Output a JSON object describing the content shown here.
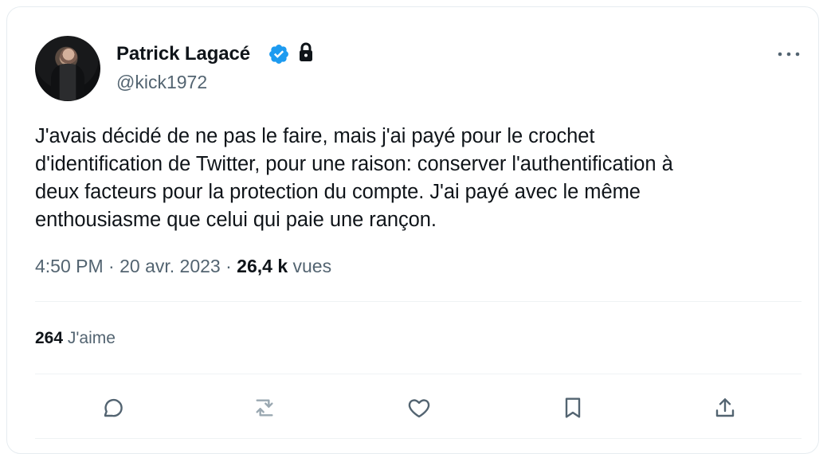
{
  "tweet": {
    "author": {
      "display_name": "Patrick Lagacé",
      "handle": "@kick1972",
      "avatar_icon": "profile-photo"
    },
    "badges": {
      "verified_icon": "verified-badge-icon",
      "verified_color": "#1d9bf0",
      "protected_icon": "lock-icon"
    },
    "more_icon": "more-horizontal-icon",
    "text": "J'avais décidé de ne pas le faire, mais j'ai payé pour le crochet\nd'identification de Twitter, pour une raison: conserver l'authentification à\ndeux facteurs pour la protection du compte. J'ai payé avec le même\nenthousiasme que celui qui paie une rançon.",
    "meta": {
      "time": "4:50 PM",
      "separator_1": " · ",
      "date": "20 avr. 2023",
      "separator_2": " · ",
      "views_count": "26,4 k",
      "views_label": "vues"
    },
    "stats": {
      "likes_count": "264",
      "likes_label": "J'aime"
    },
    "actions": [
      {
        "name": "reply",
        "icon": "reply-icon"
      },
      {
        "name": "retweet",
        "icon": "retweet-icon"
      },
      {
        "name": "like",
        "icon": "heart-icon"
      },
      {
        "name": "bookmark",
        "icon": "bookmark-icon"
      },
      {
        "name": "share",
        "icon": "share-icon"
      }
    ],
    "colors": {
      "text_primary": "#0f1419",
      "text_secondary": "#536471",
      "divider": "#eff3f4",
      "retweet_icon": "#536471"
    }
  }
}
